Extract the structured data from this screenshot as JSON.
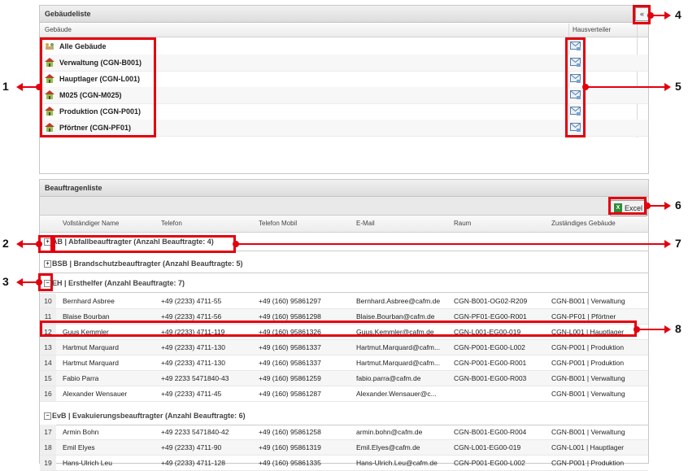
{
  "buildings_panel": {
    "title": "Gebäudeliste",
    "col_building": "Gebäude",
    "col_distributor": "Hausverteiler",
    "items": [
      {
        "label": "Alle Gebäude"
      },
      {
        "label": "Verwaltung (CGN-B001)"
      },
      {
        "label": "Hauptlager (CGN-L001)"
      },
      {
        "label": "M025 (CGN-M025)"
      },
      {
        "label": "Produktion (CGN-P001)"
      },
      {
        "label": "Pförtner (CGN-PF01)"
      }
    ],
    "collapse_glyph": "«"
  },
  "commissioners_panel": {
    "title": "Beauftragenliste",
    "excel_label": "Excel",
    "excel_icon": "X",
    "columns": [
      "Vollständiger Name",
      "Telefon",
      "Telefon Mobil",
      "E-Mail",
      "Raum",
      "Zuständiges Gebäude"
    ],
    "groups": [
      {
        "toggle": "+",
        "label": "AB | Abfallbeauftragter (Anzahl Beauftragte: 4)"
      },
      {
        "toggle": "+",
        "label": "BSB | Brandschutzbeauftragter (Anzahl Beauftragte: 5)"
      },
      {
        "toggle": "−",
        "label": "EH | Ersthelfer (Anzahl Beauftragte: 7)"
      },
      {
        "toggle": "−",
        "label": "EvB | Evakuierungsbeauftragter (Anzahl Beauftragte: 6)"
      }
    ],
    "eh_rows": [
      [
        "10",
        "Bernhard Asbree",
        "+49 (2233) 4711-55",
        "+49 (160) 95861297",
        "Bernhard.Asbree@cafm.de",
        "CGN-B001-OG02-R209",
        "CGN-B001 | Verwaltung"
      ],
      [
        "11",
        "Blaise Bourban",
        "+49 (2233) 4711-56",
        "+49 (160) 95861298",
        "Blaise.Bourban@cafm.de",
        "CGN-PF01-EG00-R001",
        "CGN-PF01 | Pförtner"
      ],
      [
        "12",
        "Guus Kemmler",
        "+49 (2233) 4711-119",
        "+49 (160) 95861326",
        "Guus.Kemmler@cafm.de",
        "CGN-L001-EG00-019",
        "CGN-L001 | Hauptlager"
      ],
      [
        "13",
        "Hartmut Marquard",
        "+49 (2233) 4711-130",
        "+49 (160) 95861337",
        "Hartmut.Marquard@cafm...",
        "CGN-P001-EG00-L002",
        "CGN-P001 | Produktion"
      ],
      [
        "14",
        "Hartmut Marquard",
        "+49 (2233) 4711-130",
        "+49 (160) 95861337",
        "Hartmut.Marquard@cafm...",
        "CGN-P001-EG00-R001",
        "CGN-P001 | Produktion"
      ],
      [
        "15",
        "Fabio Parra",
        "+49 2233 5471840-43",
        "+49 (160) 95861259",
        "fabio.parra@cafm.de",
        "CGN-B001-EG00-R003",
        "CGN-B001 | Verwaltung"
      ],
      [
        "16",
        "Alexander Wensauer",
        "+49 (2233) 4711-45",
        "+49 (160) 95861287",
        "Alexander.Wensauer@c...",
        "",
        "CGN-B001 | Verwaltung"
      ]
    ],
    "evb_rows": [
      [
        "17",
        "Armin Bohn",
        "+49 2233 5471840-42",
        "+49 (160) 95861258",
        "armin.bohn@cafm.de",
        "CGN-B001-EG00-R004",
        "CGN-B001 | Verwaltung"
      ],
      [
        "18",
        "Emil Elyes",
        "+49 (2233) 4711-90",
        "+49 (160) 95861319",
        "Emil.Elyes@cafm.de",
        "CGN-L001-EG00-019",
        "CGN-L001 | Hauptlager"
      ],
      [
        "19",
        "Hans-Ulrich Leu",
        "+49 (2233) 4711-128",
        "+49 (160) 95861335",
        "Hans-Ulrich.Leu@cafm.de",
        "CGN-P001-EG00-L002",
        "CGN-P001 | Produktion"
      ]
    ]
  },
  "callouts": [
    "1",
    "2",
    "3",
    "4",
    "5",
    "6",
    "7",
    "8"
  ],
  "colors": {
    "highlight": "#e3000f"
  }
}
